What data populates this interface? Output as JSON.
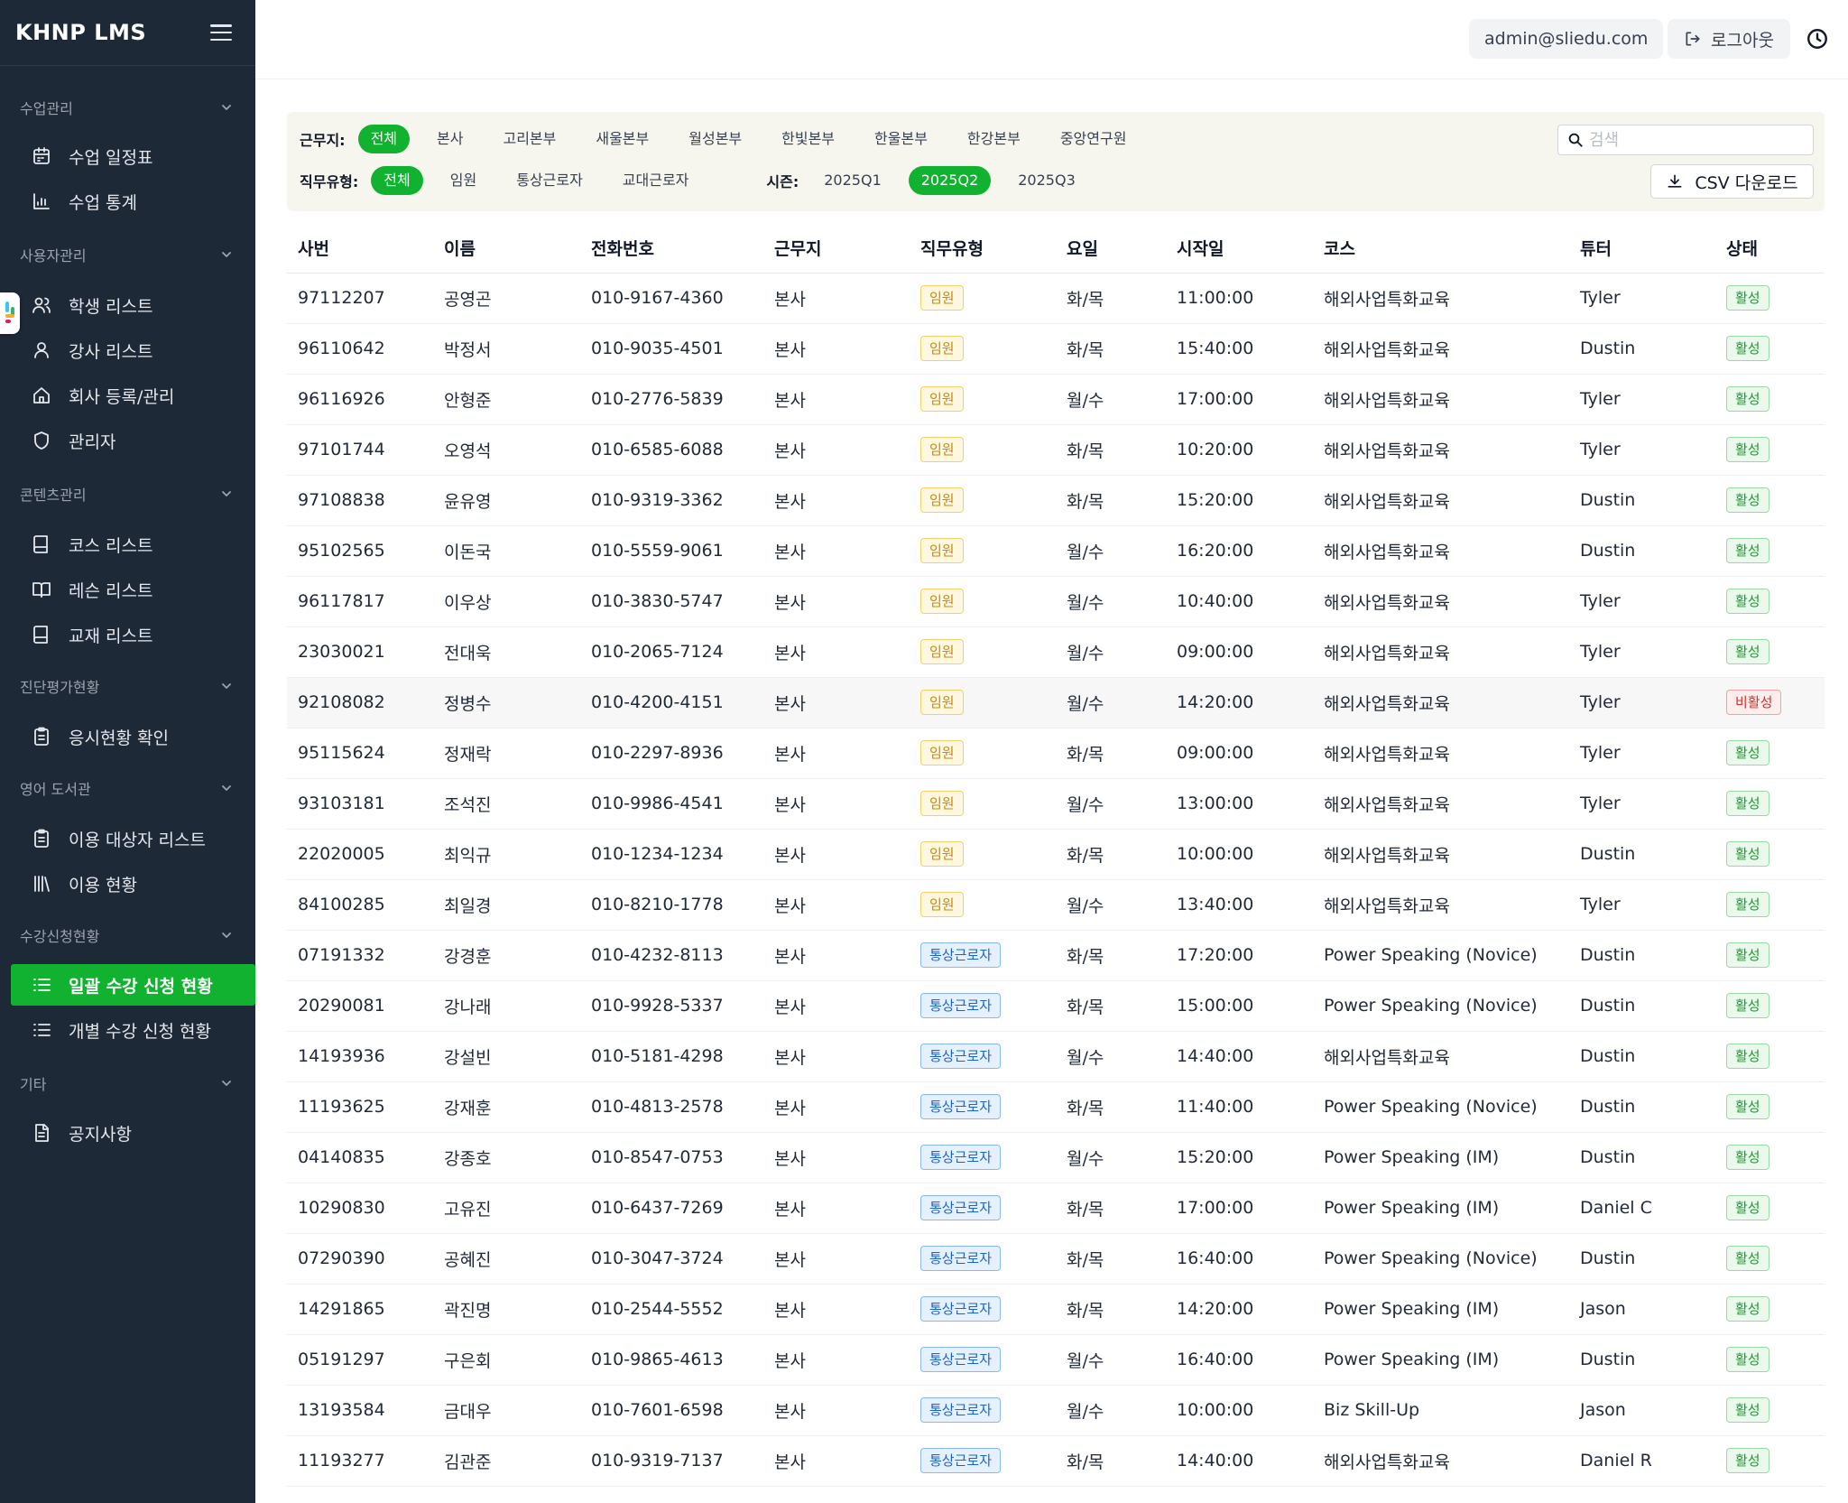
{
  "app": {
    "title": "KHNP LMS"
  },
  "sidebar": {
    "sections": [
      {
        "header": "수업관리",
        "items": [
          {
            "label": "수업 일정표",
            "icon": "calendar-icon"
          },
          {
            "label": "수업 통계",
            "icon": "bar-chart-icon"
          }
        ]
      },
      {
        "header": "사용자관리",
        "items": [
          {
            "label": "학생 리스트",
            "icon": "users-icon"
          },
          {
            "label": "강사 리스트",
            "icon": "user-icon"
          },
          {
            "label": "회사 등록/관리",
            "icon": "home-icon"
          },
          {
            "label": "관리자",
            "icon": "shield-icon"
          }
        ]
      },
      {
        "header": "콘텐츠관리",
        "items": [
          {
            "label": "코스 리스트",
            "icon": "book-icon"
          },
          {
            "label": "레슨 리스트",
            "icon": "open-book-icon"
          },
          {
            "label": "교재 리스트",
            "icon": "book-icon"
          }
        ]
      },
      {
        "header": "진단평가현황",
        "items": [
          {
            "label": "응시현황 확인",
            "icon": "clipboard-icon"
          }
        ]
      },
      {
        "header": "영어 도서관",
        "items": [
          {
            "label": "이용 대상자 리스트",
            "icon": "clipboard-icon"
          },
          {
            "label": "이용 현황",
            "icon": "library-icon"
          }
        ]
      },
      {
        "header": "수강신청현황",
        "items": [
          {
            "label": "일괄 수강 신청 현황",
            "icon": "list-icon",
            "active": true
          },
          {
            "label": "개별 수강 신청 현황",
            "icon": "list-icon"
          }
        ]
      },
      {
        "header": "기타",
        "items": [
          {
            "label": "공지사항",
            "icon": "document-icon"
          }
        ]
      }
    ]
  },
  "header": {
    "user_email": "admin@sliedu.com",
    "logout_label": "로그아웃"
  },
  "filters": {
    "location_label": "근무지:",
    "locations": [
      "전체",
      "본사",
      "고리본부",
      "새울본부",
      "월성본부",
      "한빛본부",
      "한울본부",
      "한강본부",
      "중앙연구원"
    ],
    "location_selected": 0,
    "jobtype_label": "직무유형:",
    "jobtypes": [
      "전체",
      "임원",
      "통상근로자",
      "교대근로자"
    ],
    "jobtype_selected": 0,
    "season_label": "시즌:",
    "seasons": [
      "2025Q1",
      "2025Q2",
      "2025Q3"
    ],
    "season_selected": 1,
    "search_placeholder": "검색",
    "csv_label": "CSV 다운로드"
  },
  "colors": {
    "sidebar_bg": "#1e2937",
    "accent_green": "#10b22f",
    "badge_exec": "#c38b09",
    "badge_regular": "#1d64c6",
    "badge_active": "#1d9a34",
    "badge_inactive": "#d0312d"
  },
  "table": {
    "columns": [
      "사번",
      "이름",
      "전화번호",
      "근무지",
      "직무유형",
      "요일",
      "시작일",
      "코스",
      "튜터",
      "상태"
    ],
    "rows": [
      [
        "97112207",
        "공영곤",
        "010-9167-4360",
        "본사",
        "임원",
        "화/목",
        "11:00:00",
        "해외사업특화교육",
        "Tyler",
        "활성"
      ],
      [
        "96110642",
        "박정서",
        "010-9035-4501",
        "본사",
        "임원",
        "화/목",
        "15:40:00",
        "해외사업특화교육",
        "Dustin",
        "활성"
      ],
      [
        "96116926",
        "안형준",
        "010-2776-5839",
        "본사",
        "임원",
        "월/수",
        "17:00:00",
        "해외사업특화교육",
        "Tyler",
        "활성"
      ],
      [
        "97101744",
        "오영석",
        "010-6585-6088",
        "본사",
        "임원",
        "화/목",
        "10:20:00",
        "해외사업특화교육",
        "Tyler",
        "활성"
      ],
      [
        "97108838",
        "윤유영",
        "010-9319-3362",
        "본사",
        "임원",
        "화/목",
        "15:20:00",
        "해외사업특화교육",
        "Dustin",
        "활성"
      ],
      [
        "95102565",
        "이돈국",
        "010-5559-9061",
        "본사",
        "임원",
        "월/수",
        "16:20:00",
        "해외사업특화교육",
        "Dustin",
        "활성"
      ],
      [
        "96117817",
        "이우상",
        "010-3830-5747",
        "본사",
        "임원",
        "월/수",
        "10:40:00",
        "해외사업특화교육",
        "Tyler",
        "활성"
      ],
      [
        "23030021",
        "전대욱",
        "010-2065-7124",
        "본사",
        "임원",
        "월/수",
        "09:00:00",
        "해외사업특화교육",
        "Tyler",
        "활성"
      ],
      [
        "92108082",
        "정병수",
        "010-4200-4151",
        "본사",
        "임원",
        "월/수",
        "14:20:00",
        "해외사업특화교육",
        "Tyler",
        "비활성"
      ],
      [
        "95115624",
        "정재락",
        "010-2297-8936",
        "본사",
        "임원",
        "화/목",
        "09:00:00",
        "해외사업특화교육",
        "Tyler",
        "활성"
      ],
      [
        "93103181",
        "조석진",
        "010-9986-4541",
        "본사",
        "임원",
        "월/수",
        "13:00:00",
        "해외사업특화교육",
        "Tyler",
        "활성"
      ],
      [
        "22020005",
        "최익규",
        "010-1234-1234",
        "본사",
        "임원",
        "화/목",
        "10:00:00",
        "해외사업특화교육",
        "Dustin",
        "활성"
      ],
      [
        "84100285",
        "최일경",
        "010-8210-1778",
        "본사",
        "임원",
        "월/수",
        "13:40:00",
        "해외사업특화교육",
        "Tyler",
        "활성"
      ],
      [
        "07191332",
        "강경훈",
        "010-4232-8113",
        "본사",
        "통상근로자",
        "화/목",
        "17:20:00",
        "Power Speaking (Novice)",
        "Dustin",
        "활성"
      ],
      [
        "20290081",
        "강나래",
        "010-9928-5337",
        "본사",
        "통상근로자",
        "화/목",
        "15:00:00",
        "Power Speaking (Novice)",
        "Dustin",
        "활성"
      ],
      [
        "14193936",
        "강설빈",
        "010-5181-4298",
        "본사",
        "통상근로자",
        "월/수",
        "14:40:00",
        "해외사업특화교육",
        "Dustin",
        "활성"
      ],
      [
        "11193625",
        "강재훈",
        "010-4813-2578",
        "본사",
        "통상근로자",
        "화/목",
        "11:40:00",
        "Power Speaking (Novice)",
        "Dustin",
        "활성"
      ],
      [
        "04140835",
        "강종호",
        "010-8547-0753",
        "본사",
        "통상근로자",
        "월/수",
        "15:20:00",
        "Power Speaking (IM)",
        "Dustin",
        "활성"
      ],
      [
        "10290830",
        "고유진",
        "010-6437-7269",
        "본사",
        "통상근로자",
        "화/목",
        "17:00:00",
        "Power Speaking (IM)",
        "Daniel C",
        "활성"
      ],
      [
        "07290390",
        "공혜진",
        "010-3047-3724",
        "본사",
        "통상근로자",
        "화/목",
        "16:40:00",
        "Power Speaking (Novice)",
        "Dustin",
        "활성"
      ],
      [
        "14291865",
        "곽진명",
        "010-2544-5552",
        "본사",
        "통상근로자",
        "화/목",
        "14:20:00",
        "Power Speaking (IM)",
        "Jason",
        "활성"
      ],
      [
        "05191297",
        "구은회",
        "010-9865-4613",
        "본사",
        "통상근로자",
        "월/수",
        "16:40:00",
        "Power Speaking (IM)",
        "Dustin",
        "활성"
      ],
      [
        "13193584",
        "금대우",
        "010-7601-6598",
        "본사",
        "통상근로자",
        "월/수",
        "10:00:00",
        "Biz Skill-Up",
        "Jason",
        "활성"
      ],
      [
        "11193277",
        "김관준",
        "010-9319-7137",
        "본사",
        "통상근로자",
        "화/목",
        "14:40:00",
        "해외사업특화교육",
        "Daniel R",
        "활성"
      ]
    ],
    "highlight_row": 8
  }
}
